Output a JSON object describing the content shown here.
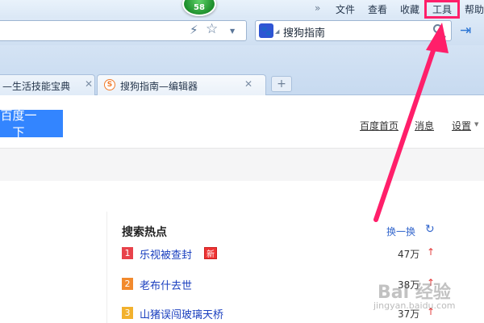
{
  "menubar": {
    "chevron": "»",
    "items": [
      "文件",
      "查看",
      "收藏",
      "工具",
      "帮助"
    ],
    "badge_count": "58"
  },
  "address_bar": {
    "icons": [
      "lightning-icon",
      "star-icon",
      "dropdown-icon"
    ]
  },
  "search_bar": {
    "engine_icon": "paw-icon",
    "value": "搜狗指南"
  },
  "tabs": [
    {
      "label": "—生活技能宝典"
    },
    {
      "label": "搜狗指南—编辑器"
    }
  ],
  "baidu": {
    "button_label": "百度一下",
    "links": [
      "百度首页",
      "消息",
      "设置"
    ]
  },
  "hot_search": {
    "title": "搜索热点",
    "refresh_label": "换一换",
    "items": [
      {
        "rank": "1",
        "text": "乐视被查封",
        "badge": "新",
        "count": "47万",
        "rank_color": "#e8424a"
      },
      {
        "rank": "2",
        "text": "老布什去世",
        "badge": "",
        "count": "38万",
        "rank_color": "#f28a2d"
      },
      {
        "rank": "3",
        "text": "山猪误闯玻璃天桥",
        "badge": "",
        "count": "37万",
        "rank_color": "#f2b12d"
      }
    ]
  },
  "annotation": {
    "color": "#ff1f6a",
    "target": "工具"
  },
  "watermark": {
    "logo": "Bai 经验",
    "url": "jingyan.baidu.com"
  }
}
